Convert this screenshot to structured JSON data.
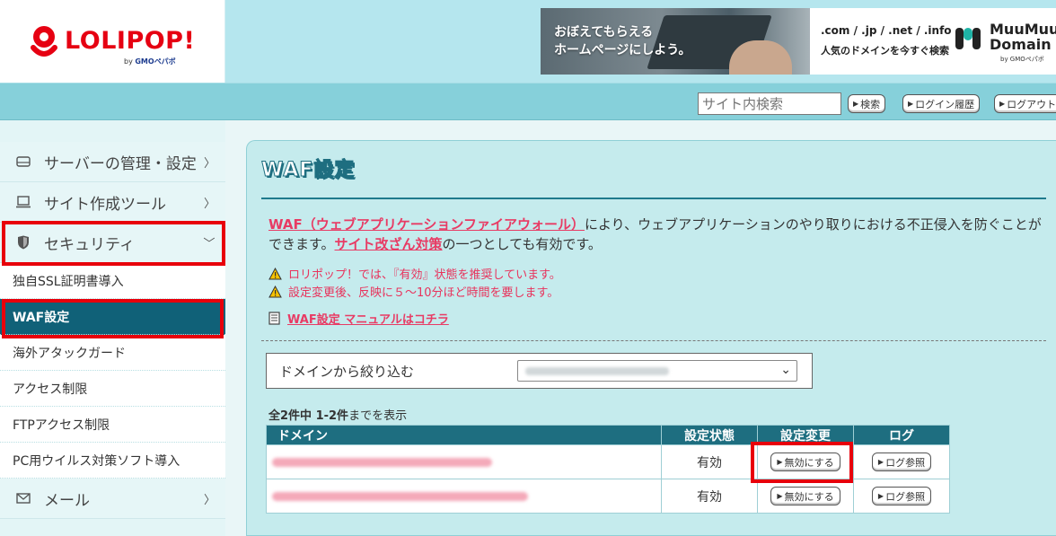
{
  "colors": {
    "brand_red": "#e60012",
    "header_bg": "#b5e6ee",
    "navbar_bg": "#86d0da",
    "accent_dark": "#106178",
    "link_pink": "#e83b64",
    "highlight_red": "#e8000b"
  },
  "logo": {
    "name": "LOLIPOP!",
    "by": "by",
    "by_company": "GMOペパボ"
  },
  "banner": {
    "left_line1": "おぼえてもらえる",
    "left_line2": "ホームページにしよう。",
    "right_top": ".com / .jp / .net / .info",
    "right_bottom": "人気のドメインを今すぐ検索",
    "brand_line1": "MuuMuu",
    "brand_line2": "Domain",
    "brand_by": "by GMOペパボ"
  },
  "navbar": {
    "search_placeholder": "サイト内検索",
    "search_button": "検索",
    "login_history_button": "ログイン履歴",
    "logout_button": "ログアウト"
  },
  "sidebar": {
    "items": [
      {
        "label": "サーバーの管理・設定",
        "icon": "server-icon"
      },
      {
        "label": "サイト作成ツール",
        "icon": "laptop-icon"
      },
      {
        "label": "セキュリティ",
        "icon": "shield-icon"
      }
    ],
    "security_sub": [
      {
        "label": "独自SSL証明書導入"
      },
      {
        "label": "WAF設定"
      },
      {
        "label": "海外アタックガード"
      },
      {
        "label": "アクセス制限"
      },
      {
        "label": "FTPアクセス制限"
      },
      {
        "label": "PC用ウイルス対策ソフト導入"
      }
    ],
    "mail": {
      "label": "メール",
      "icon": "mail-icon"
    }
  },
  "main": {
    "title": "WAF設定",
    "desc_link1": "WAF（ウェブアプリケーションファイアウォール）",
    "desc_text1": "により、ウェブアプリケーションのやり取りにおける不正侵入を防ぐことができます。",
    "desc_link2": "サイト改ざん対策",
    "desc_text2": "の一つとしても有効です。",
    "warning1": "ロリポップ！では、『有効』状態を推奨しています。",
    "warning2": "設定変更後、反映に５〜10分ほど時間を要します。",
    "manual_link": "WAF設定 マニュアルはコチラ",
    "filter_label": "ドメインから絞り込む",
    "count_bold": "全2件中 1-2件",
    "count_text": "までを表示",
    "table": {
      "headers": [
        "ドメイン",
        "設定状態",
        "設定変更",
        "ログ"
      ],
      "rows": [
        {
          "status": "有効",
          "change_button": "無効にする",
          "log_button": "ログ参照"
        },
        {
          "status": "有効",
          "change_button": "無効にする",
          "log_button": "ログ参照"
        }
      ]
    }
  }
}
